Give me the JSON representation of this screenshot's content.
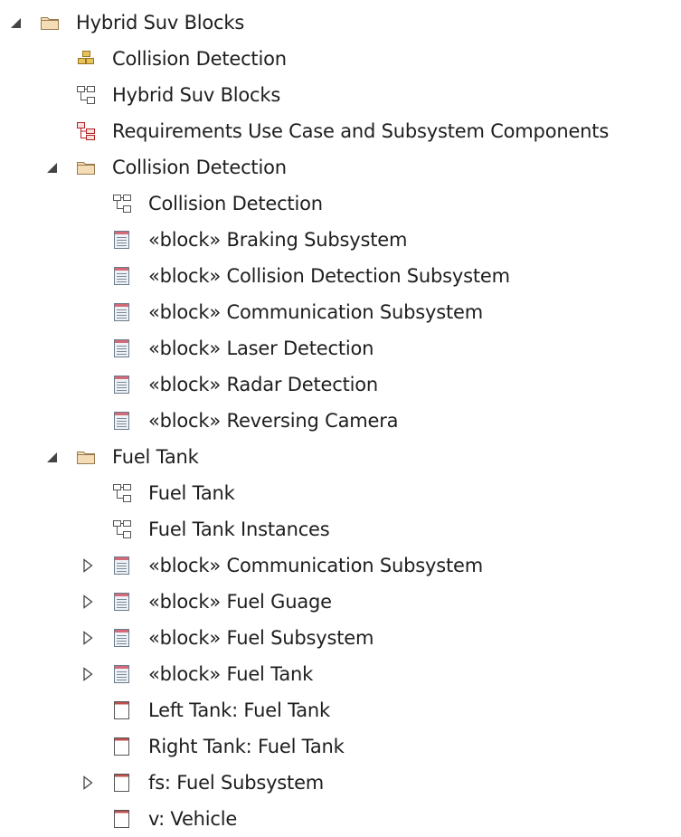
{
  "tree": [
    {
      "label": "Hybrid Suv Blocks",
      "level": 0,
      "icon": "folder-icon",
      "toggle": "expanded"
    },
    {
      "label": "Collision Detection",
      "level": 1,
      "icon": "package-diagram-icon",
      "toggle": "none"
    },
    {
      "label": "Hybrid Suv Blocks",
      "level": 1,
      "icon": "block-diagram-icon",
      "toggle": "none"
    },
    {
      "label": "Requirements Use Case and Subsystem Components",
      "level": 1,
      "icon": "requirements-diagram-icon",
      "toggle": "none"
    },
    {
      "label": "Collision Detection",
      "level": 1,
      "icon": "folder-icon",
      "toggle": "expanded"
    },
    {
      "label": "Collision Detection",
      "level": 2,
      "icon": "block-diagram-icon",
      "toggle": "none"
    },
    {
      "label": "«block» Braking Subsystem",
      "level": 2,
      "icon": "block-element-icon",
      "toggle": "none"
    },
    {
      "label": "«block» Collision Detection Subsystem",
      "level": 2,
      "icon": "block-element-icon",
      "toggle": "none"
    },
    {
      "label": "«block» Communication Subsystem",
      "level": 2,
      "icon": "block-element-icon",
      "toggle": "none"
    },
    {
      "label": "«block» Laser Detection",
      "level": 2,
      "icon": "block-element-icon",
      "toggle": "none"
    },
    {
      "label": "«block» Radar Detection",
      "level": 2,
      "icon": "block-element-icon",
      "toggle": "none"
    },
    {
      "label": "«block» Reversing Camera",
      "level": 2,
      "icon": "block-element-icon",
      "toggle": "none"
    },
    {
      "label": "Fuel Tank",
      "level": 1,
      "icon": "folder-icon",
      "toggle": "expanded"
    },
    {
      "label": "Fuel Tank",
      "level": 2,
      "icon": "block-diagram-icon",
      "toggle": "none"
    },
    {
      "label": "Fuel Tank Instances",
      "level": 2,
      "icon": "block-diagram-icon",
      "toggle": "none"
    },
    {
      "label": "«block» Communication Subsystem",
      "level": 2,
      "icon": "block-element-icon",
      "toggle": "collapsed"
    },
    {
      "label": "«block» Fuel Guage",
      "level": 2,
      "icon": "block-element-icon",
      "toggle": "collapsed"
    },
    {
      "label": "«block» Fuel Subsystem",
      "level": 2,
      "icon": "block-element-icon",
      "toggle": "collapsed"
    },
    {
      "label": "«block» Fuel Tank",
      "level": 2,
      "icon": "block-element-icon",
      "toggle": "collapsed"
    },
    {
      "label": "Left Tank: Fuel Tank",
      "level": 2,
      "icon": "instance-icon",
      "toggle": "none"
    },
    {
      "label": "Right Tank: Fuel Tank",
      "level": 2,
      "icon": "instance-icon",
      "toggle": "none"
    },
    {
      "label": "fs: Fuel Subsystem",
      "level": 2,
      "icon": "instance-icon",
      "toggle": "collapsed"
    },
    {
      "label": "v: Vehicle",
      "level": 2,
      "icon": "instance-icon",
      "toggle": "none"
    }
  ],
  "colors": {
    "folder_fill": "#f3dcb6",
    "folder_stroke": "#9a7b4f",
    "package_fill": "#e8c25a",
    "package_stroke": "#9a7420",
    "diagram_stroke": "#555555",
    "requirements_accent": "#b22222",
    "block_header": "#d46a78",
    "block_body": "#eef2f6",
    "instance_header": "#c0504d",
    "toggle": "#444444"
  }
}
